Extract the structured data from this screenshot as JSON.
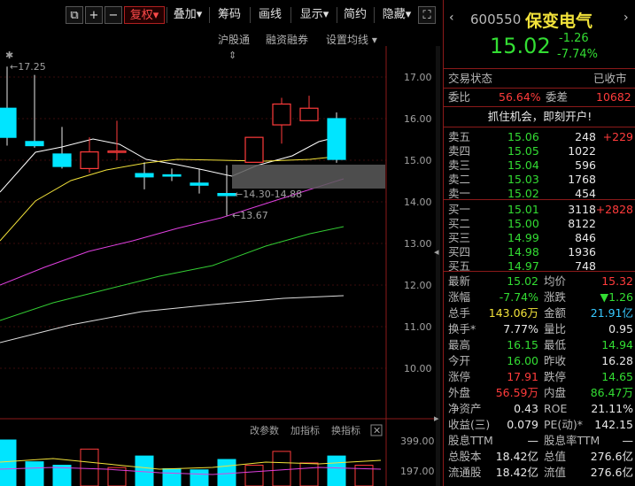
{
  "toolbar": {
    "fuquan": "复权",
    "diejia": "叠加",
    "chouma": "筹码",
    "huaxian": "画线",
    "xianshi": "显示",
    "jianyue": "简约",
    "yincang": "隐藏"
  },
  "subbar": {
    "hgt": "沪股通",
    "rzrq": "融资融券",
    "settings": "设置均线"
  },
  "chart": {
    "price_axis": [
      "17.00",
      "16.00",
      "15.00",
      "14.00",
      "13.00",
      "12.00",
      "11.00",
      "10.00"
    ],
    "high_label": "17.25",
    "low_label": "13.67",
    "range_label": "14.30-14.88",
    "vol_axis": [
      "399.00",
      "197.00"
    ],
    "vol_tabs": [
      "改参数",
      "加指标",
      "换指标"
    ],
    "candles": [
      {
        "o": 16.25,
        "c": 15.55,
        "h": 17.25,
        "l": 15.35
      },
      {
        "o": 15.45,
        "c": 15.35,
        "h": 17.05,
        "l": 15.3
      },
      {
        "o": 15.15,
        "c": 14.85,
        "h": 15.8,
        "l": 14.8
      },
      {
        "o": 14.8,
        "c": 15.2,
        "h": 15.55,
        "l": 14.7
      },
      {
        "o": 15.2,
        "c": 15.22,
        "h": 15.95,
        "l": 15.0
      },
      {
        "o": 14.68,
        "c": 14.6,
        "h": 14.95,
        "l": 14.3
      },
      {
        "o": 14.65,
        "c": 14.62,
        "h": 14.8,
        "l": 14.5
      },
      {
        "o": 14.45,
        "c": 14.4,
        "h": 14.8,
        "l": 14.2
      },
      {
        "o": 14.2,
        "c": 14.15,
        "h": 14.88,
        "l": 13.67
      },
      {
        "o": 14.95,
        "c": 15.55,
        "h": 15.55,
        "l": 14.95
      },
      {
        "o": 15.85,
        "c": 16.35,
        "h": 16.5,
        "l": 15.4
      },
      {
        "o": 15.95,
        "c": 16.25,
        "h": 16.55,
        "l": 15.95
      },
      {
        "o": 16.0,
        "c": 15.02,
        "h": 16.15,
        "l": 14.94
      }
    ],
    "volumes": [
      399,
      210,
      180,
      320,
      160,
      260,
      150,
      140,
      230,
      180,
      300,
      200,
      260,
      180
    ]
  },
  "header": {
    "code": "600550",
    "name": "保变电气",
    "price": "15.02",
    "change": "-1.26",
    "change_pct": "-7.74%"
  },
  "status": {
    "label": "交易状态",
    "value": "已收市"
  },
  "weibi": {
    "l1": "委比",
    "v1": "56.64%",
    "l2": "委差",
    "v2": "10682"
  },
  "promo": "抓住机会，即刻开户!",
  "sells": [
    {
      "label": "卖五",
      "price": "15.06",
      "vol": "248",
      "chg": "+229"
    },
    {
      "label": "卖四",
      "price": "15.05",
      "vol": "1022",
      "chg": ""
    },
    {
      "label": "卖三",
      "price": "15.04",
      "vol": "596",
      "chg": ""
    },
    {
      "label": "卖二",
      "price": "15.03",
      "vol": "1768",
      "chg": ""
    },
    {
      "label": "卖一",
      "price": "15.02",
      "vol": "454",
      "chg": ""
    }
  ],
  "buys": [
    {
      "label": "买一",
      "price": "15.01",
      "vol": "3118",
      "chg": "+2828"
    },
    {
      "label": "买二",
      "price": "15.00",
      "vol": "8122",
      "chg": ""
    },
    {
      "label": "买三",
      "price": "14.99",
      "vol": "846",
      "chg": ""
    },
    {
      "label": "买四",
      "price": "14.98",
      "vol": "1936",
      "chg": ""
    },
    {
      "label": "买五",
      "price": "14.97",
      "vol": "748",
      "chg": ""
    }
  ],
  "stats": [
    {
      "l1": "最新",
      "v1": "15.02",
      "c1": "green",
      "l2": "均价",
      "v2": "15.32",
      "c2": "red"
    },
    {
      "l1": "涨幅",
      "v1": "-7.74%",
      "c1": "green",
      "l2": "涨跌",
      "v2": "▼1.26",
      "c2": "green"
    },
    {
      "l1": "总手",
      "v1": "143.06万",
      "c1": "yellow",
      "l2": "金额",
      "v2": "21.91亿",
      "c2": "cyan"
    },
    {
      "l1": "换手*",
      "v1": "7.77%",
      "c1": "white",
      "l2": "量比",
      "v2": "0.95",
      "c2": "white"
    },
    {
      "l1": "最高",
      "v1": "16.15",
      "c1": "green",
      "l2": "最低",
      "v2": "14.94",
      "c2": "green"
    },
    {
      "l1": "今开",
      "v1": "16.00",
      "c1": "green",
      "l2": "昨收",
      "v2": "16.28",
      "c2": "white"
    },
    {
      "l1": "涨停",
      "v1": "17.91",
      "c1": "red",
      "l2": "跌停",
      "v2": "14.65",
      "c2": "green"
    },
    {
      "l1": "外盘",
      "v1": "56.59万",
      "c1": "red",
      "l2": "内盘",
      "v2": "86.47万",
      "c2": "green"
    },
    {
      "l1": "净资产",
      "v1": "0.43",
      "c1": "white",
      "l2": "ROE",
      "v2": "21.11%",
      "c2": "white"
    },
    {
      "l1": "收益(三)",
      "v1": "0.079",
      "c1": "white",
      "l2": "PE(动)*",
      "v2": "142.15",
      "c2": "white"
    },
    {
      "l1": "股息TTM",
      "v1": "—",
      "c1": "white",
      "l2": "股息率TTM",
      "v2": "—",
      "c2": "white"
    },
    {
      "l1": "总股本",
      "v1": "18.42亿",
      "c1": "white",
      "l2": "总值",
      "v2": "276.6亿",
      "c2": "white"
    },
    {
      "l1": "流通股",
      "v1": "18.42亿",
      "c1": "white",
      "l2": "流值",
      "v2": "276.6亿",
      "c2": "white"
    }
  ],
  "colors": {
    "up": "#ff3b3b",
    "down": "#33dd33",
    "cyan": "#00e5ff",
    "yellow": "#f2e23a"
  }
}
